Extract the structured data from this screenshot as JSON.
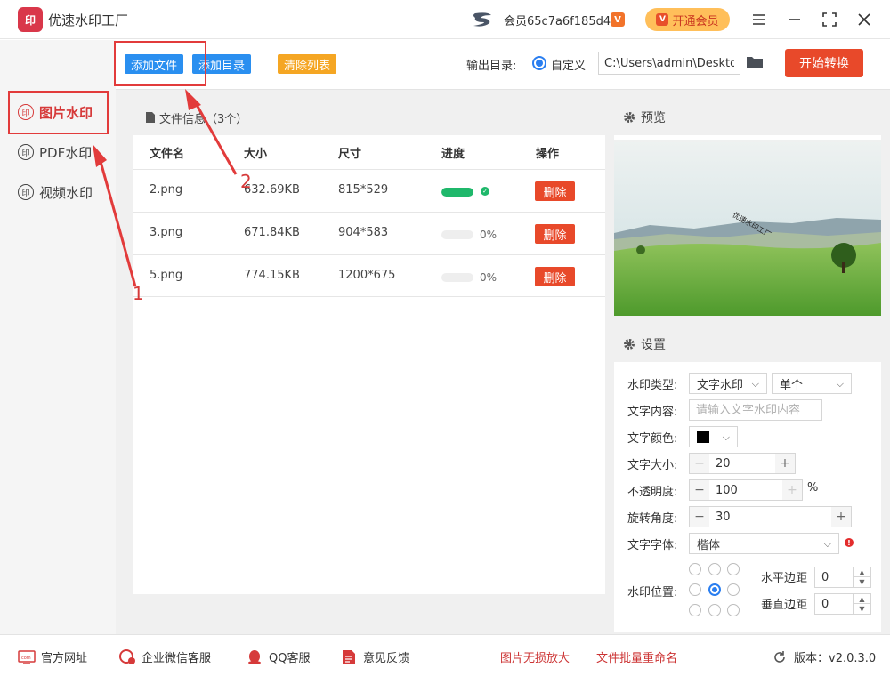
{
  "app": {
    "title": "优速水印工厂",
    "logo_text": "印"
  },
  "header": {
    "member_text": "会员65c7a6f185d4",
    "vip_button": "开通会员",
    "vip_mark": "V"
  },
  "sidebar": {
    "items": [
      {
        "label": "图片水印",
        "icon": "印",
        "active": true
      },
      {
        "label": "PDF水印",
        "icon": "印",
        "active": false
      },
      {
        "label": "视频水印",
        "icon": "印",
        "active": false
      }
    ]
  },
  "toolbar": {
    "add_file": "添加文件",
    "add_dir": "添加目录",
    "clear_list": "清除列表",
    "output_label": "输出目录:",
    "custom_label": "自定义",
    "output_path": "C:\\Users\\admin\\Desktop",
    "start_button": "开始转换"
  },
  "files": {
    "header": "文件信息（3个）",
    "columns": [
      "文件名",
      "大小",
      "尺寸",
      "进度",
      "操作"
    ],
    "delete_label": "删除",
    "rows": [
      {
        "name": "2.png",
        "size": "632.69KB",
        "dims": "815*529",
        "progress": 1.0,
        "progress_text": ""
      },
      {
        "name": "3.png",
        "size": "671.84KB",
        "dims": "904*583",
        "progress": 0,
        "progress_text": "0%"
      },
      {
        "name": "5.png",
        "size": "774.15KB",
        "dims": "1200*675",
        "progress": 0,
        "progress_text": "0%"
      }
    ]
  },
  "preview": {
    "title": "预览",
    "watermark_text": "优速水印工厂"
  },
  "settings": {
    "title": "设置",
    "type_label": "水印类型:",
    "type_value": "文字水印",
    "mode_value": "单个",
    "content_label": "文字内容:",
    "content_placeholder": "请输入文字水印内容",
    "color_label": "文字颜色:",
    "color_value": "#000000",
    "size_label": "文字大小:",
    "size_value": "20",
    "opacity_label": "不透明度:",
    "opacity_value": "100",
    "opacity_unit": "%",
    "rotate_label": "旋转角度:",
    "rotate_value": "30",
    "font_label": "文字字体:",
    "font_value": "楷体",
    "position_label": "水印位置:",
    "h_margin_label": "水平边距",
    "h_margin_value": "0",
    "v_margin_label": "垂直边距",
    "v_margin_value": "0"
  },
  "footer": {
    "website": "官方网址",
    "wechat": "企业微信客服",
    "qq": "QQ客服",
    "feedback": "意见反馈",
    "lossless": "图片无损放大",
    "rename": "文件批量重命名",
    "version": "版本：v2.0.3.0"
  },
  "annotations": {
    "step1": "1",
    "step2": "2"
  },
  "colors": {
    "accent_red": "#e8492a",
    "blue": "#2a7ef0",
    "orange": "#f5a623",
    "annotation": "#e23b3b"
  }
}
